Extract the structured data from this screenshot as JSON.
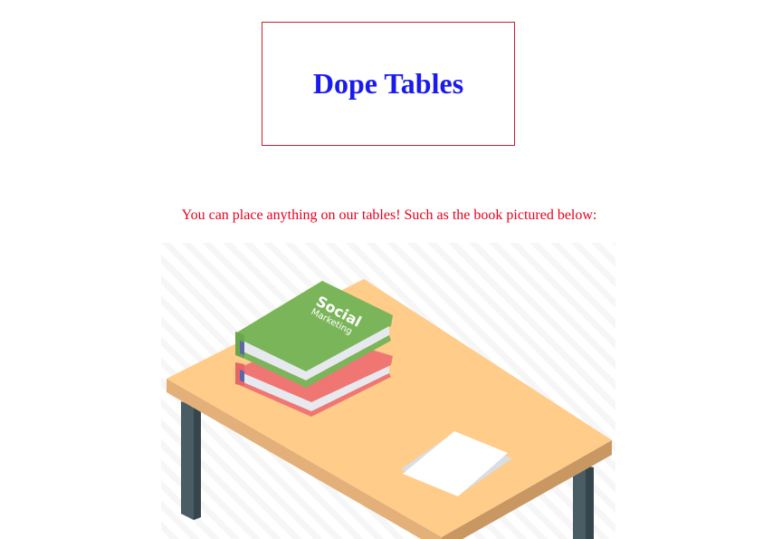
{
  "header": {
    "title": "Dope Tables"
  },
  "main": {
    "intro_text": "You can place anything on our tables! Such as the book pictured below:",
    "illustration": {
      "book_title": "Social",
      "book_subtitle": "Marketing"
    }
  },
  "colors": {
    "title": "#1a1af0",
    "intro": "#e8001d",
    "header_border": "#cc1f2f",
    "table_top": "#ffcc8a",
    "table_edge": "#dcaa74",
    "table_leg": "#4a5d65",
    "book_green": "#7ab55a",
    "book_red": "#f07674"
  }
}
